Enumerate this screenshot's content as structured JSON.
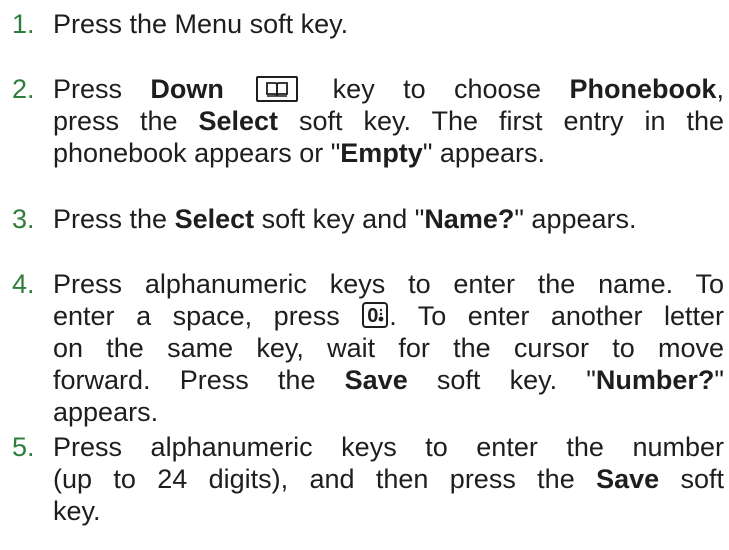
{
  "steps": [
    {
      "number": "1.",
      "lines": [
        {
          "parts": [
            "Press the Menu soft key."
          ]
        }
      ]
    },
    {
      "number": "2.",
      "lines": [
        {
          "parts": [
            "Press ",
            "Down",
            " key to choose ",
            "Phonebook",
            ","
          ]
        },
        {
          "parts": [
            "press the ",
            "Select",
            " soft key. The first entry in the"
          ]
        },
        {
          "parts": [
            "phonebook appears or \"",
            "Empty",
            "\" appears."
          ]
        }
      ]
    },
    {
      "number": "3.",
      "lines": [
        {
          "parts": [
            "Press the ",
            "Select",
            " soft key and \"",
            "Name?",
            "\" appears."
          ]
        }
      ]
    },
    {
      "number": "4.",
      "lines": [
        {
          "parts": [
            "Press alphanumeric keys to enter the name. To"
          ]
        },
        {
          "parts": [
            "enter a space, press ",
            ". To enter another letter"
          ]
        },
        {
          "parts": [
            "on the same key, wait for the cursor to move"
          ]
        },
        {
          "parts": [
            "forward. Press the ",
            "Save",
            " soft key. \"",
            "Number?",
            "\""
          ]
        },
        {
          "parts": [
            "appears."
          ]
        }
      ]
    },
    {
      "number": "5.",
      "lines": [
        {
          "parts": [
            "Press alphanumeric keys to enter the number"
          ]
        },
        {
          "parts": [
            "(up to 24 digits), and then press the ",
            "Save",
            " soft"
          ]
        },
        {
          "parts": [
            "key."
          ]
        }
      ]
    }
  ],
  "icons": {
    "phonebook_key": "phonebook-book-icon",
    "zero_key": "zero-space-key-icon",
    "zero_key_label": "0"
  },
  "colors": {
    "step_number": "#2e7d3a",
    "text": "#1e1e1e"
  }
}
